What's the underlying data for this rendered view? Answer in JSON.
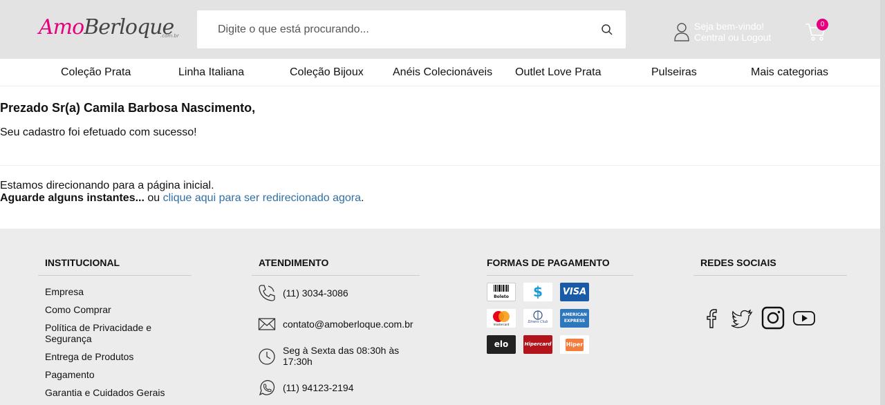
{
  "header": {
    "logo_part1": "Amo",
    "logo_part2": "Berloque",
    "logo_suffix": ".com.br",
    "search_placeholder": "Digite o que está procurando...",
    "welcome_line1": "Seja bem-vindo!",
    "welcome_line2": "Central ou Logout",
    "cart_count": "0"
  },
  "nav": {
    "items": [
      "Coleção Prata",
      "Linha Italiana",
      "Coleção Bijoux",
      "Anéis Colecionáveis",
      "Outlet Love Prata",
      "Pulseiras",
      "Mais categorias"
    ]
  },
  "main": {
    "title": "Prezado Sr(a) Camila Barbosa Nascimento,",
    "success": "Seu cadastro foi efetuado com sucesso!",
    "redirect_line1": "Estamos direcionando para a página inicial.",
    "redirect_bold": "Aguarde alguns instantes...",
    "redirect_or": " ou ",
    "redirect_link": "clique aqui para ser redirecionado agora",
    "redirect_end": "."
  },
  "footer": {
    "institucional": {
      "heading": "INSTITUCIONAL",
      "links": [
        "Empresa",
        "Como Comprar",
        "Política de Privacidade e Segurança",
        "Entrega de Produtos",
        "Pagamento",
        "Garantia e Cuidados Gerais"
      ]
    },
    "atendimento": {
      "heading": "ATENDIMENTO",
      "phone": "(11) 3034-3086",
      "email": "contato@amoberloque.com.br",
      "hours": "Seg à  Sexta das 08:30h às 17:30h",
      "whatsapp": "(11) 94123-2194"
    },
    "pagamento": {
      "heading": "FORMAS DE PAGAMENTO",
      "methods": {
        "boleto": "Boleto",
        "dollar": "$",
        "visa": "VISA",
        "mastercard": "mastercard",
        "diners": "Diners Club",
        "amex": "AMERICAN EXPRESS",
        "elo": "elo",
        "hipercard": "Hipercard",
        "hiper": "Hiper"
      }
    },
    "redes": {
      "heading": "REDES SOCIAIS"
    }
  },
  "colors": {
    "brand_pink": "#e6007e",
    "link_blue": "#2f6fa6",
    "header_bg": "#e3e3e3",
    "footer_bg": "#ececec"
  }
}
